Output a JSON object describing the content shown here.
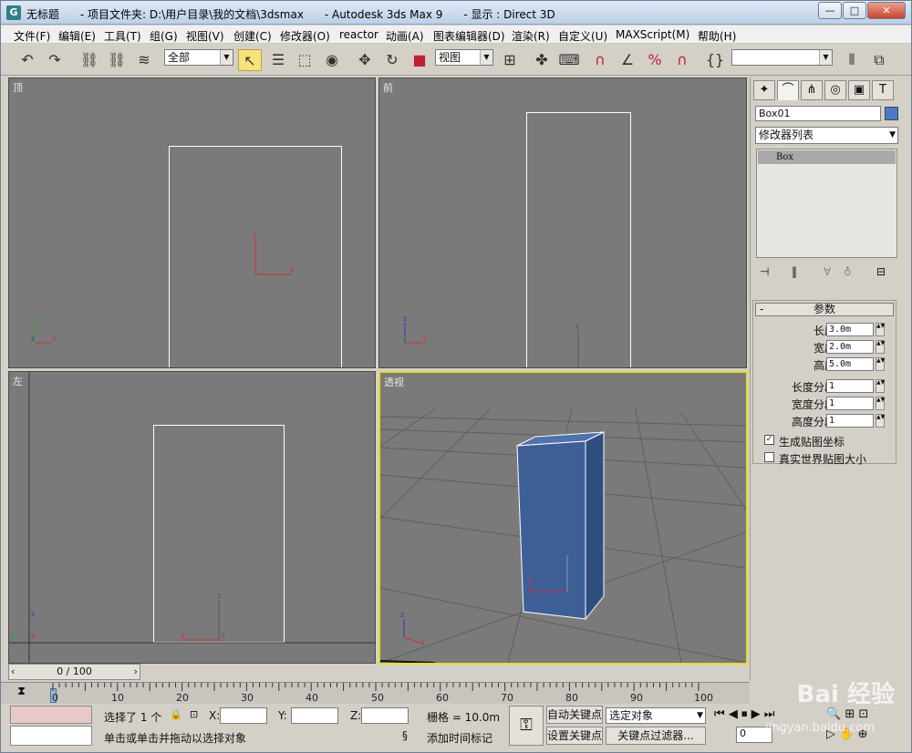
{
  "window": {
    "title": "无标题      - 项目文件夹: D:\\用户目录\\我的文档\\3dsmax      - Autodesk 3ds Max 9      - 显示 : Direct 3D",
    "app_icon_glyph": "G"
  },
  "window_controls": {
    "minimize": "—",
    "maximize": "□",
    "close": "✕"
  },
  "menu": {
    "items": [
      "文件(F)",
      "编辑(E)",
      "工具(T)",
      "组(G)",
      "视图(V)",
      "创建(C)",
      "修改器(O)",
      "reactor",
      "动画(A)",
      "图表编辑器(D)",
      "渲染(R)",
      "自定义(U)",
      "MAXScript(M)",
      "帮助(H)"
    ]
  },
  "toolbar": {
    "selection_filter": "全部",
    "ref_coord": "视图",
    "named_selection": ""
  },
  "viewports": {
    "top": {
      "label": "顶"
    },
    "front": {
      "label": "前"
    },
    "left": {
      "label": "左"
    },
    "perspective": {
      "label": "透视",
      "object_color": "#3d5f95"
    }
  },
  "command_panel": {
    "object_name": "Box01",
    "object_color": "#4a7cc9",
    "modifier_list": "修改器列表",
    "stack_item": "Box",
    "rollout_title": "参数",
    "params": [
      {
        "label": "长度:",
        "value": "3.0m"
      },
      {
        "label": "宽度:",
        "value": "2.0m"
      },
      {
        "label": "高度:",
        "value": "5.0m"
      },
      {
        "label": "长度分段:",
        "value": "1"
      },
      {
        "label": "宽度分段:",
        "value": "1"
      },
      {
        "label": "高度分段:",
        "value": "1"
      }
    ],
    "gen_mapping": {
      "label": "生成贴图坐标",
      "checked": true
    },
    "real_world": {
      "label": "真实世界贴图大小",
      "checked": false
    }
  },
  "timeline": {
    "slider_text": "0 / 100",
    "ticks": [
      "0",
      "10",
      "20",
      "30",
      "40",
      "50",
      "60",
      "70",
      "80",
      "90",
      "100"
    ]
  },
  "status": {
    "selection": "选择了 1 个",
    "x_label": "X:",
    "y_label": "Y:",
    "z_label": "Z:",
    "grid": "栅格 = 10.0m",
    "auto_key": "自动关键点",
    "set_key": "设置关键点",
    "selected_object": "选定对象",
    "key_filters": "关键点过滤器...",
    "prompt": "单击或单击并拖动以选择对象",
    "add_time_tag": "添加时间标记",
    "frame": "0"
  },
  "watermark": {
    "brand": "Bai 经验",
    "url": "jingyan.baidu.com"
  }
}
